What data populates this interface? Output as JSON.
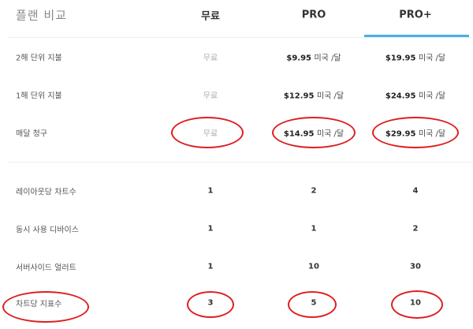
{
  "table": {
    "title": "플랜 비교",
    "columns": [
      "무료",
      "PRO",
      "PRO+"
    ],
    "billing_rows": [
      {
        "label": "2해 단위 지불",
        "free": "무료",
        "pro_price": "$9.95",
        "pro_unit": "미국 /달",
        "proplus_price": "$19.95",
        "proplus_unit": "미국 /달"
      },
      {
        "label": "1해 단위 지불",
        "free": "무료",
        "pro_price": "$12.95",
        "pro_unit": "미국 /달",
        "proplus_price": "$24.95",
        "proplus_unit": "미국 /달"
      },
      {
        "label": "매달 청구",
        "free": "무료",
        "pro_price": "$14.95",
        "pro_unit": "미국 /달",
        "proplus_price": "$29.95",
        "proplus_unit": "미국 /달"
      }
    ],
    "feature_rows": [
      {
        "label": "레이아웃당 차트수",
        "free": "1",
        "pro": "2",
        "proplus": "4"
      },
      {
        "label": "동시 사용 디바이스",
        "free": "1",
        "pro": "1",
        "proplus": "2"
      },
      {
        "label": "서버사이드 얼러트",
        "free": "1",
        "pro": "10",
        "proplus": "30"
      },
      {
        "label": "차트당 지표수",
        "free": "3",
        "pro": "5",
        "proplus": "10"
      }
    ]
  },
  "colors": {
    "accent": "#45b3e0",
    "highlight_circle": "#dd1f1f"
  }
}
